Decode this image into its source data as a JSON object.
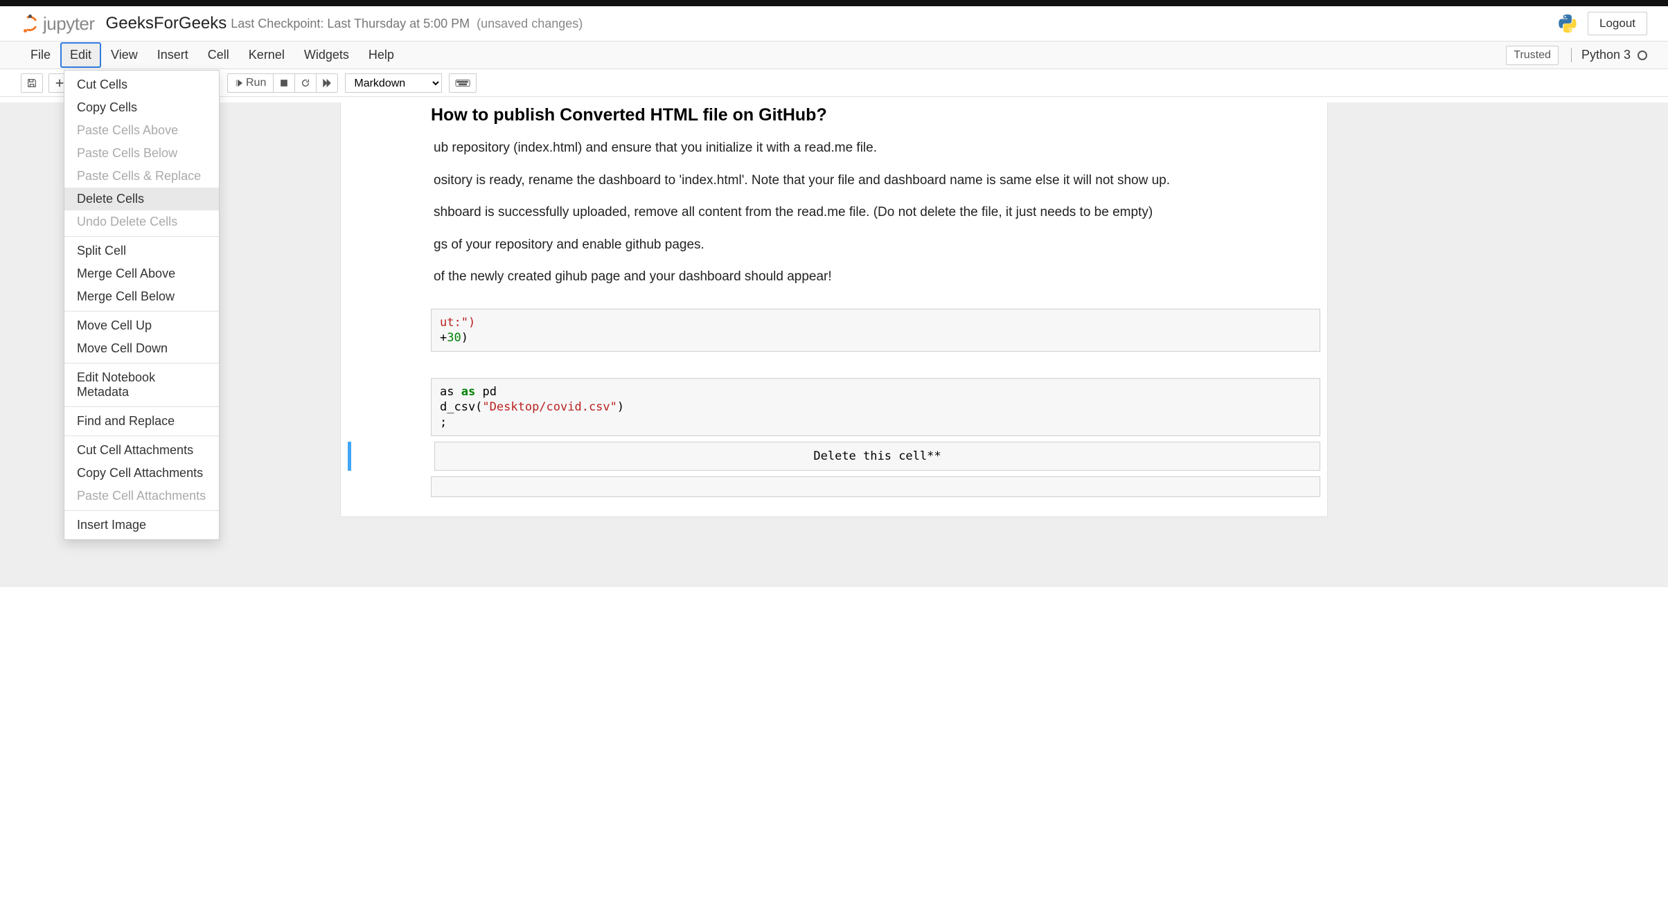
{
  "header": {
    "logo_text": "jupyter",
    "notebook_name": "GeeksForGeeks",
    "checkpoint": "Last Checkpoint: Last Thursday at 5:00 PM",
    "unsaved": "(unsaved changes)",
    "logout": "Logout"
  },
  "menubar": {
    "items": [
      "File",
      "Edit",
      "View",
      "Insert",
      "Cell",
      "Kernel",
      "Widgets",
      "Help"
    ],
    "active_index": 1,
    "trusted": "Trusted",
    "kernel_name": "Python 3"
  },
  "toolbar": {
    "run_label": "Run",
    "celltype": "Markdown"
  },
  "dropdown": {
    "groups": [
      [
        {
          "label": "Cut Cells",
          "enabled": true,
          "hover": false
        },
        {
          "label": "Copy Cells",
          "enabled": true,
          "hover": false
        },
        {
          "label": "Paste Cells Above",
          "enabled": false,
          "hover": false
        },
        {
          "label": "Paste Cells Below",
          "enabled": false,
          "hover": false
        },
        {
          "label": "Paste Cells & Replace",
          "enabled": false,
          "hover": false
        },
        {
          "label": "Delete Cells",
          "enabled": true,
          "hover": true
        },
        {
          "label": "Undo Delete Cells",
          "enabled": false,
          "hover": false
        }
      ],
      [
        {
          "label": "Split Cell",
          "enabled": true,
          "hover": false
        },
        {
          "label": "Merge Cell Above",
          "enabled": true,
          "hover": false
        },
        {
          "label": "Merge Cell Below",
          "enabled": true,
          "hover": false
        }
      ],
      [
        {
          "label": "Move Cell Up",
          "enabled": true,
          "hover": false
        },
        {
          "label": "Move Cell Down",
          "enabled": true,
          "hover": false
        }
      ],
      [
        {
          "label": "Edit Notebook Metadata",
          "enabled": true,
          "hover": false
        }
      ],
      [
        {
          "label": "Find and Replace",
          "enabled": true,
          "hover": false
        }
      ],
      [
        {
          "label": "Cut Cell Attachments",
          "enabled": true,
          "hover": false
        },
        {
          "label": "Copy Cell Attachments",
          "enabled": true,
          "hover": false
        },
        {
          "label": "Paste Cell Attachments",
          "enabled": false,
          "hover": false
        }
      ],
      [
        {
          "label": "Insert Image",
          "enabled": true,
          "hover": false
        }
      ]
    ]
  },
  "content": {
    "md_heading_suffix": " How to publish Converted HTML file on GitHub?",
    "step1_suffix": "ub repository (index.html) and ensure that you initialize it with a read.me file.",
    "step2_suffix": "ository is ready, rename the dashboard to 'index.html'. Note that your file and dashboard name is same else it will not show up.",
    "step3_suffix": "shboard is successfully uploaded, remove all content from the read.me file. (Do not delete the file, it just needs to be empty)",
    "step4_suffix": "gs of your repository and enable github pages.",
    "step5_suffix": "of the newly created gihub page and your dashboard should appear!"
  },
  "code1": {
    "prompt": "",
    "line1_suffix": "ut:\")",
    "line2_suffix": "+",
    "line2_num": "30",
    "line2_close": ")"
  },
  "output1": {
    "text": ""
  },
  "code2": {
    "prompt": "",
    "import_as": "as",
    "as_kw": "as",
    "pd": " pd",
    "read_fn": "d_csv(",
    "read_str": "\"Desktop/covid.csv\"",
    "read_close": ")",
    "line3": ";"
  },
  "raw_cell": {
    "text": "Delete this cell**"
  }
}
